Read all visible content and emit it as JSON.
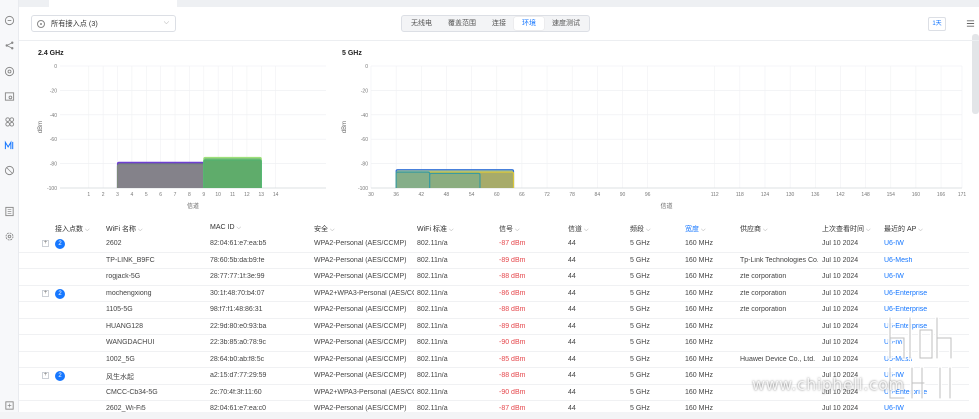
{
  "toolbar": {
    "ap_filter": "所有接入点 (3)",
    "tabs": [
      {
        "label": "无线电",
        "active": false
      },
      {
        "label": "覆盖范围",
        "active": false
      },
      {
        "label": "连接",
        "active": false
      },
      {
        "label": "环境",
        "active": true
      },
      {
        "label": "速度测试",
        "active": false
      }
    ],
    "time_range": "1天"
  },
  "rail_icons": [
    "home-icon",
    "topology-icon",
    "target-icon",
    "devices-icon",
    "clients-icon",
    "wifiman-icon",
    "shield-icon",
    "list-icon",
    "settings-icon",
    "tools-icon"
  ],
  "chart_data": [
    {
      "type": "area",
      "title": "2.4 GHz",
      "xlabel": "信道",
      "ylabel": "dBm",
      "ylim": [
        -100,
        0
      ],
      "y_ticks": [
        "0",
        "-20",
        "-40",
        "-60",
        "-80",
        "-100"
      ],
      "x_ticks": [
        "1",
        "2",
        "3",
        "4",
        "5",
        "6",
        "7",
        "8",
        "9",
        "10",
        "11",
        "12",
        "13",
        "14"
      ],
      "series": [
        {
          "from_channel": 3,
          "to_channel": 9,
          "top_dbm": -79,
          "color": "#6d3fd1",
          "fill": "#5a4d86"
        },
        {
          "from_channel": 3,
          "to_channel": 9,
          "top_dbm": -81,
          "color": "#7d8a7a",
          "fill": "#878787"
        },
        {
          "from_channel": 9,
          "to_channel": 13,
          "top_dbm": -75,
          "color": "#9ee07a",
          "fill": "#6bb865"
        },
        {
          "from_channel": 9,
          "to_channel": 13,
          "top_dbm": -77,
          "color": "#4fb370",
          "fill": "#59a868"
        }
      ]
    },
    {
      "type": "area",
      "title": "5 GHz",
      "xlabel": "信道",
      "ylabel": "dBm",
      "ylim": [
        -100,
        0
      ],
      "y_ticks": [
        "0",
        "-20",
        "-40",
        "-60",
        "-80",
        "-100"
      ],
      "x_ticks": [
        "30",
        "36",
        "42",
        "48",
        "54",
        "60",
        "66",
        "72",
        "78",
        "84",
        "90",
        "96",
        "112",
        "118",
        "124",
        "130",
        "136",
        "142",
        "148",
        "154",
        "160",
        "166",
        "171"
      ],
      "series": [
        {
          "from_channel": 36,
          "to_channel": 64,
          "top_dbm": -85,
          "color": "#2f6fd6",
          "fill": "#8ab08a"
        },
        {
          "from_channel": 36,
          "to_channel": 64,
          "top_dbm": -87,
          "color": "#d8c63c",
          "fill": "#a9a862"
        },
        {
          "from_channel": 36,
          "to_channel": 44,
          "top_dbm": -87,
          "color": "#3a9aa0",
          "fill": "#7fae8e"
        },
        {
          "from_channel": 44,
          "to_channel": 56,
          "top_dbm": -88,
          "color": "#3a9aa0",
          "fill": "#86ad84"
        }
      ]
    }
  ],
  "table": {
    "headers": {
      "ap_count": "接入点数",
      "wifi": "WiFi 名称",
      "mac": "MAC ID",
      "security": "安全",
      "standard": "WiFi 标准",
      "signal": "信号",
      "channel": "信道",
      "band": "频段",
      "width": "宽度",
      "vendor": "供应商",
      "last_seen": "上次查看时间",
      "recent_ap": "最近的 AP"
    },
    "rows": [
      {
        "expand": true,
        "count": "2",
        "wifi": "2602",
        "mac": "82:04:61:e7:ea:b5",
        "security": "WPA2-Personal (AES/CCMP)",
        "standard": "802.11n/a",
        "signal": "-87 dBm",
        "channel": "44",
        "band": "5 GHz",
        "width": "160 MHz",
        "vendor": "",
        "last_seen": "Jul 10 2024",
        "ap": "U6-IW"
      },
      {
        "expand": false,
        "count": "",
        "wifi": "TP-LINK_B9FC",
        "mac": "78:60:5b:da:b9:fe",
        "security": "WPA2-Personal (AES/CCMP)",
        "standard": "802.11n/a",
        "signal": "-89 dBm",
        "channel": "44",
        "band": "5 GHz",
        "width": "160 MHz",
        "vendor": "Tp-Link Technologies Co.,",
        "last_seen": "Jul 10 2024",
        "ap": "U6-Mesh"
      },
      {
        "expand": false,
        "count": "",
        "wifi": "rogjack-5G",
        "mac": "28:77:77:1f:3e:99",
        "security": "WPA2-Personal (AES/CCMP)",
        "standard": "802.11n/a",
        "signal": "-88 dBm",
        "channel": "44",
        "band": "5 GHz",
        "width": "160 MHz",
        "vendor": "zte corporation",
        "last_seen": "Jul 10 2024",
        "ap": "U6-IW"
      },
      {
        "expand": true,
        "count": "2",
        "wifi": "mochengxiong",
        "mac": "30:1f:48:70:b4:07",
        "security": "WPA2+WPA3-Personal (AES/CC",
        "standard": "802.11n/a",
        "signal": "-86 dBm",
        "channel": "44",
        "band": "5 GHz",
        "width": "160 MHz",
        "vendor": "zte corporation",
        "last_seen": "Jul 10 2024",
        "ap": "U6-Enterprise"
      },
      {
        "expand": false,
        "count": "",
        "wifi": "1105-5G",
        "mac": "98:f7:f1:48:86:31",
        "security": "WPA2-Personal (AES/CCMP)",
        "standard": "802.11n/a",
        "signal": "-88 dBm",
        "channel": "44",
        "band": "5 GHz",
        "width": "160 MHz",
        "vendor": "zte corporation",
        "last_seen": "Jul 10 2024",
        "ap": "U6-Enterprise"
      },
      {
        "expand": false,
        "count": "",
        "wifi": "HUANG128",
        "mac": "22:9d:80:e0:93:ba",
        "security": "WPA2-Personal (AES/CCMP)",
        "standard": "802.11n/a",
        "signal": "-89 dBm",
        "channel": "44",
        "band": "5 GHz",
        "width": "160 MHz",
        "vendor": "",
        "last_seen": "Jul 10 2024",
        "ap": "U6-Enterprise"
      },
      {
        "expand": false,
        "count": "",
        "wifi": "WANGDACHUI",
        "mac": "22:3b:85:a0:78:9c",
        "security": "WPA2-Personal (AES/CCMP)",
        "standard": "802.11n/a",
        "signal": "-90 dBm",
        "channel": "44",
        "band": "5 GHz",
        "width": "160 MHz",
        "vendor": "",
        "last_seen": "Jul 10 2024",
        "ap": "U6-IW"
      },
      {
        "expand": false,
        "count": "",
        "wifi": "1002_5G",
        "mac": "28:64:b0:ab:f8:5c",
        "security": "WPA2-Personal (AES/CCMP)",
        "standard": "802.11n/a",
        "signal": "-85 dBm",
        "channel": "44",
        "band": "5 GHz",
        "width": "160 MHz",
        "vendor": "Huawei Device Co., Ltd.",
        "last_seen": "Jul 10 2024",
        "ap": "U6-Mesh"
      },
      {
        "expand": true,
        "count": "2",
        "wifi": "风生水起",
        "mac": "a2:15:d7:77:29:59",
        "security": "WPA2-Personal (AES/CCMP)",
        "standard": "802.11n/a",
        "signal": "-88 dBm",
        "channel": "44",
        "band": "5 GHz",
        "width": "160 MHz",
        "vendor": "",
        "last_seen": "Jul 10 2024",
        "ap": "U6-IW"
      },
      {
        "expand": false,
        "count": "",
        "wifi": "CMCC-Cb34-5G",
        "mac": "2c:70:4f:3f:11:60",
        "security": "WPA2+WPA3-Personal (AES/CC",
        "standard": "802.11n/a",
        "signal": "-90 dBm",
        "channel": "44",
        "band": "5 GHz",
        "width": "160 MHz",
        "vendor": "",
        "last_seen": "Jul 10 2024",
        "ap": "U6-Enterprise"
      },
      {
        "expand": false,
        "count": "",
        "wifi": "2602_Wi-Fi5",
        "mac": "82:04:61:e7:ea:c0",
        "security": "WPA2-Personal (AES/CCMP)",
        "standard": "802.11n/a",
        "signal": "-87 dBm",
        "channel": "44",
        "band": "5 GHz",
        "width": "160 MHz",
        "vendor": "",
        "last_seen": "Jul 10 2024",
        "ap": "U6-IW"
      }
    ]
  },
  "watermark": "www.chiphell.com",
  "colors": {
    "accent": "#1677ff",
    "signal": "#e5484d"
  }
}
